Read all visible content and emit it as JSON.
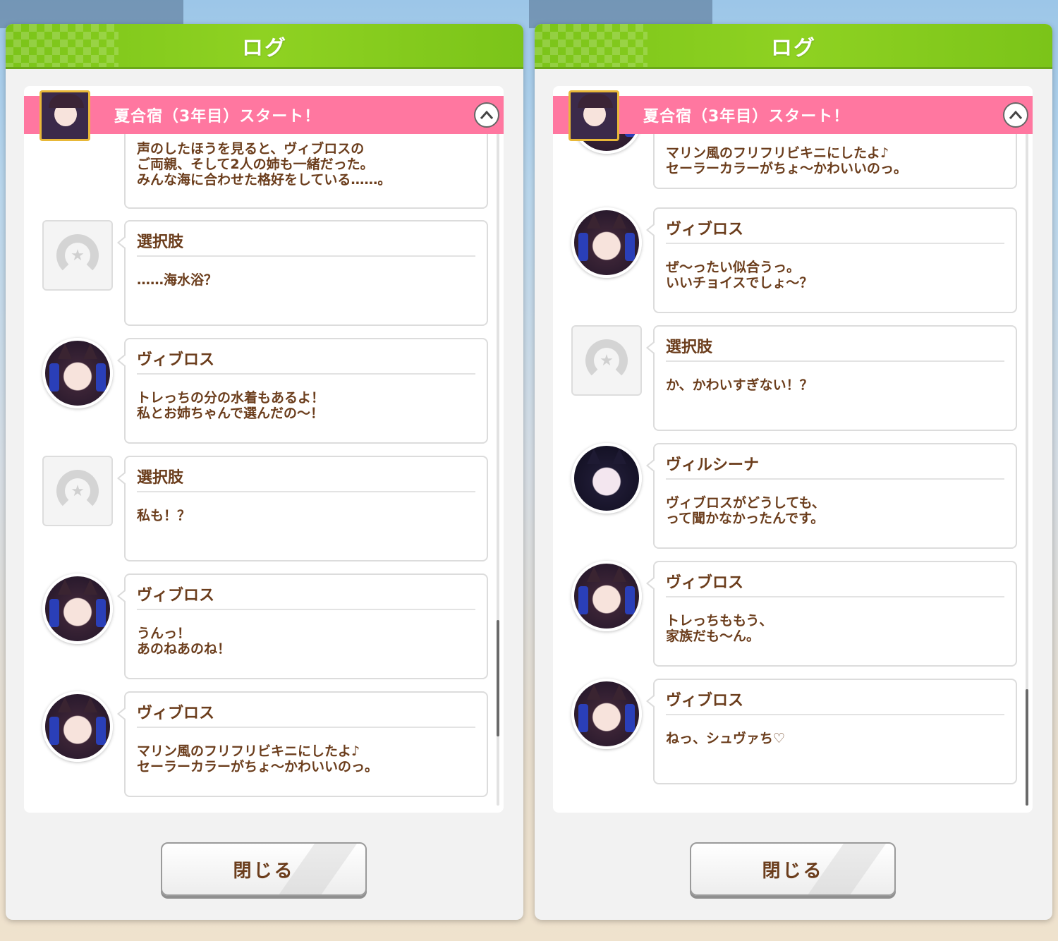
{
  "panels": [
    {
      "title": "ログ",
      "chapter_title": "夏合宿（3年目）スタート！",
      "collapse_glyph": "^",
      "close_label": "閉じる",
      "entries": [
        {
          "type": "narration",
          "text": "声のしたほうを見ると、ヴィブロスの\nご両親、そして2人の姉も一緒だった。\nみんな海に合わせた格好をしている……。"
        },
        {
          "type": "choice",
          "speaker": "選択肢",
          "text": "……海水浴？"
        },
        {
          "type": "char",
          "speaker": "ヴィブロス",
          "text": "トレっちの分の水着もあるよ！\n私とお姉ちゃんで選んだの～！"
        },
        {
          "type": "choice",
          "speaker": "選択肢",
          "text": "私も！？"
        },
        {
          "type": "char",
          "speaker": "ヴィブロス",
          "text": "うんっ！\nあのねあのね！"
        },
        {
          "type": "char",
          "speaker": "ヴィブロス",
          "text": "マリン風のフリフリビキニにしたよ♪\nセーラーカラーがちょ～かわいいのっ。"
        }
      ],
      "scroll_fraction": 0.88
    },
    {
      "title": "ログ",
      "chapter_title": "夏合宿（3年目）スタート！",
      "collapse_glyph": "^",
      "close_label": "閉じる",
      "entries": [
        {
          "type": "char",
          "speaker": "",
          "text": "マリン風のフリフリビキニにしたよ♪\nセーラーカラーがちょ～かわいいのっ。"
        },
        {
          "type": "char",
          "speaker": "ヴィブロス",
          "text": "ぜ～ったい似合うっ。\nいいチョイスでしょ～？"
        },
        {
          "type": "choice",
          "speaker": "選択肢",
          "text": "か、かわいすぎない！？"
        },
        {
          "type": "char2",
          "speaker": "ヴィルシーナ",
          "text": "ヴィブロスがどうしても、\nって聞かなかったんです。"
        },
        {
          "type": "char",
          "speaker": "ヴィブロス",
          "text": "トレっちももう、\n家族だも～ん。"
        },
        {
          "type": "char",
          "speaker": "ヴィブロス",
          "text": "ねっ、シュヴァち♡"
        }
      ],
      "scroll_fraction": 1.0
    }
  ],
  "colors": {
    "header_green": "#7bc419",
    "chapter_pink": "#ff77a0",
    "text_brown": "#6b3d1c"
  },
  "icons": {
    "choice_avatar": "horseshoe-icon",
    "collapse": "chevron-up-icon"
  }
}
